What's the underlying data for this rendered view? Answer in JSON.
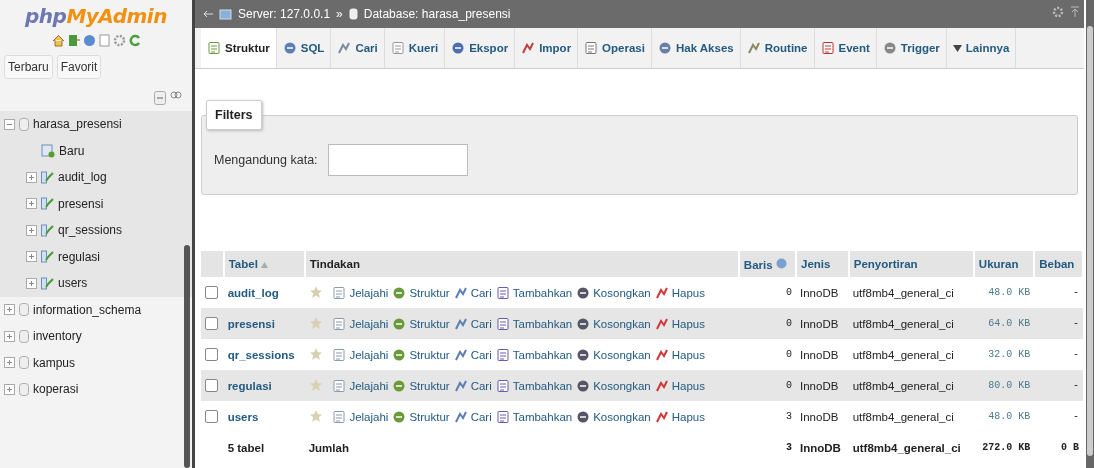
{
  "sidebar": {
    "logo": {
      "prefix": "php",
      "suffix": "MyAdmin"
    },
    "nav_buttons": [
      {
        "label": "Terbaru"
      },
      {
        "label": "Favorit"
      }
    ],
    "tree": [
      {
        "label": "harasa_presensi",
        "kind": "database",
        "expanded": true,
        "children": [
          {
            "label": "Baru",
            "kind": "new"
          },
          {
            "label": "audit_log",
            "kind": "table",
            "expanded": false
          },
          {
            "label": "presensi",
            "kind": "table",
            "expanded": false
          },
          {
            "label": "qr_sessions",
            "kind": "table",
            "expanded": false
          },
          {
            "label": "regulasi",
            "kind": "table",
            "expanded": false
          },
          {
            "label": "users",
            "kind": "table",
            "expanded": false
          }
        ]
      },
      {
        "label": "information_schema",
        "kind": "database",
        "expanded": false
      },
      {
        "label": "inventory",
        "kind": "database",
        "expanded": false
      },
      {
        "label": "kampus",
        "kind": "database",
        "expanded": false
      },
      {
        "label": "koperasi",
        "kind": "database",
        "expanded": false
      }
    ]
  },
  "breadcrumb": {
    "server": "Server: 127.0.0.1",
    "separator": "»",
    "database": "Database: harasa_presensi"
  },
  "tabs": [
    {
      "label": "Struktur",
      "selected": true
    },
    {
      "label": "SQL",
      "selected": false
    },
    {
      "label": "Cari",
      "selected": false
    },
    {
      "label": "Kueri",
      "selected": false
    },
    {
      "label": "Ekspor",
      "selected": false
    },
    {
      "label": "Impor",
      "selected": false
    },
    {
      "label": "Operasi",
      "selected": false
    },
    {
      "label": "Hak Akses",
      "selected": false
    },
    {
      "label": "Routine",
      "selected": false
    },
    {
      "label": "Event",
      "selected": false
    },
    {
      "label": "Trigger",
      "selected": false
    },
    {
      "label": "Lainnya",
      "selected": false,
      "kind": "more"
    }
  ],
  "filters": {
    "legend": "Filters",
    "label": "Mengandung kata:"
  },
  "table": {
    "columns": [
      "Tabel",
      "Tindakan",
      "Baris",
      "Jenis",
      "Penyortiran",
      "Ukuran",
      "Beban"
    ],
    "rows": [
      {
        "name": "audit_log",
        "checked": false,
        "favorite": false,
        "actions": [
          "Jelajahi",
          "Struktur",
          "Cari",
          "Tambahkan",
          "Kosongkan",
          "Hapus"
        ],
        "rows": "0",
        "type": "InnoDB",
        "collation": "utf8mb4_general_ci",
        "size": "48.0 KB",
        "overhead": "-"
      },
      {
        "name": "presensi",
        "checked": false,
        "favorite": false,
        "actions": [
          "Jelajahi",
          "Struktur",
          "Cari",
          "Tambahkan",
          "Kosongkan",
          "Hapus"
        ],
        "rows": "0",
        "type": "InnoDB",
        "collation": "utf8mb4_general_ci",
        "size": "64.0 KB",
        "overhead": "-"
      },
      {
        "name": "qr_sessions",
        "checked": false,
        "favorite": false,
        "actions": [
          "Jelajahi",
          "Struktur",
          "Cari",
          "Tambahkan",
          "Kosongkan",
          "Hapus"
        ],
        "rows": "0",
        "type": "InnoDB",
        "collation": "utf8mb4_general_ci",
        "size": "32.0 KB",
        "overhead": "-"
      },
      {
        "name": "regulasi",
        "checked": false,
        "favorite": false,
        "actions": [
          "Jelajahi",
          "Struktur",
          "Cari",
          "Tambahkan",
          "Kosongkan",
          "Hapus"
        ],
        "rows": "0",
        "type": "InnoDB",
        "collation": "utf8mb4_general_ci",
        "size": "80.0 KB",
        "overhead": "-"
      },
      {
        "name": "users",
        "checked": false,
        "favorite": false,
        "actions": [
          "Jelajahi",
          "Struktur",
          "Cari",
          "Tambahkan",
          "Kosongkan",
          "Hapus"
        ],
        "rows": "3",
        "type": "InnoDB",
        "collation": "utf8mb4_general_ci",
        "size": "48.0 KB",
        "overhead": "-"
      }
    ],
    "footer": {
      "count": "5 tabel",
      "label": "Jumlah",
      "rows": "3",
      "type": "InnoDB",
      "collation": "utf8mb4_general_ci",
      "size": "272.0 KB",
      "overhead": "0 B"
    }
  }
}
